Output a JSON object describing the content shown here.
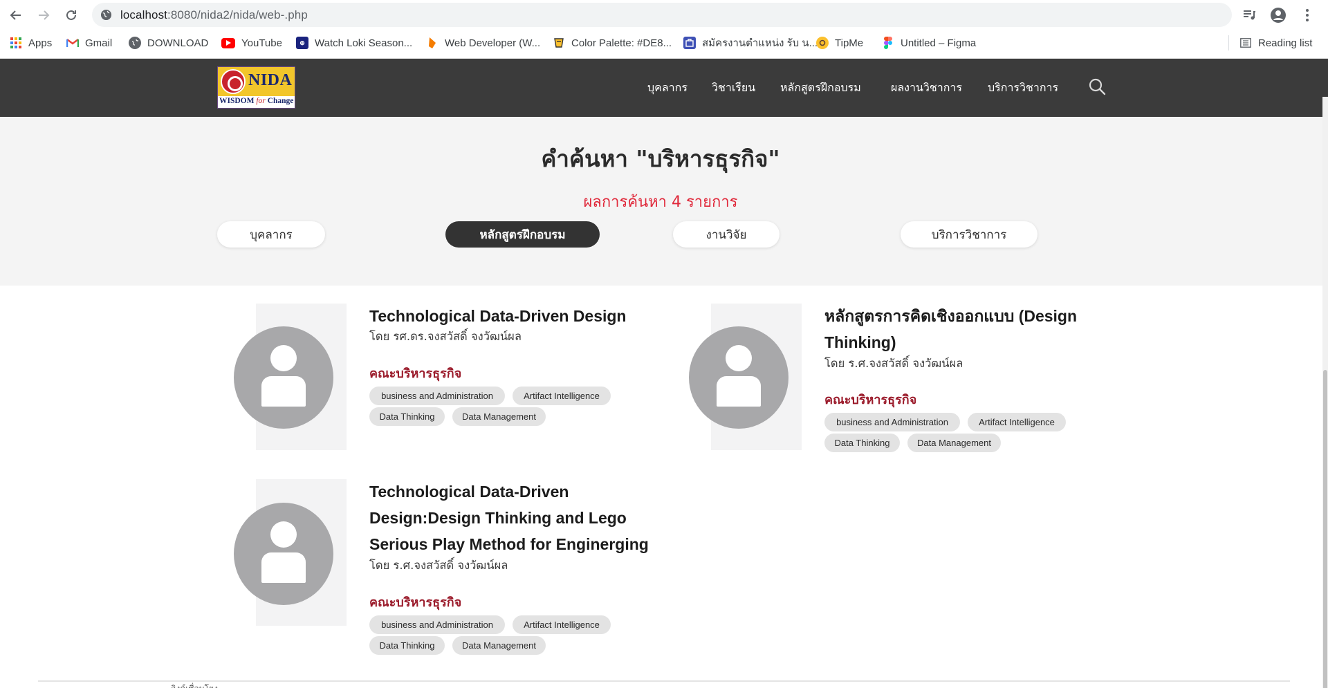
{
  "browser": {
    "url_host": "localhost",
    "url_path": ":8080/nida2/nida/web-.php",
    "bookmarks": [
      {
        "label": "Apps",
        "icon": "apps-grid-icon"
      },
      {
        "label": "Gmail",
        "icon": "gmail-icon"
      },
      {
        "label": "DOWNLOAD",
        "icon": "globe-icon"
      },
      {
        "label": "YouTube",
        "icon": "youtube-icon"
      },
      {
        "label": "Watch Loki Season...",
        "icon": "site-favicon"
      },
      {
        "label": "Web Developer (W...",
        "icon": "site-favicon"
      },
      {
        "label": "Color Palette: #DE8...",
        "icon": "site-favicon"
      },
      {
        "label": "สมัครงานตำแหน่ง รับ น...",
        "icon": "site-favicon"
      },
      {
        "label": "TipMe",
        "icon": "tipme-icon"
      },
      {
        "label": "Untitled – Figma",
        "icon": "figma-icon"
      }
    ],
    "reading_list": "Reading list"
  },
  "header": {
    "logo_name": "NIDA",
    "logo_tagline_a": "WISDOM ",
    "logo_tagline_b": "for",
    "logo_tagline_c": " Change",
    "menu": [
      "บุคลากร",
      "วิชาเรียน",
      "หลักสูตรฝึกอบรม",
      "ผลงานวิชาการ",
      "บริการวิชาการ"
    ]
  },
  "search": {
    "title": "คำค้นหา \"บริหารธุรกิจ\"",
    "result_count": "ผลการค้นหา 4 รายการ",
    "tabs": [
      "บุคลากร",
      "หลักสูตรฝึกอบรม",
      "งานวิจัย",
      "บริการวิชาการ"
    ],
    "active_tab_index": 1
  },
  "results": [
    {
      "title": "Technological Data-Driven Design",
      "author": "โดย รศ.ดร.จงสวัสดิ์ จงวัฒน์ผล",
      "faculty": "คณะบริหารธุรกิจ",
      "tags": [
        "business and Administration",
        "Artifact Intelligence",
        "Data Thinking",
        "Data Management"
      ]
    },
    {
      "title": "หลักสูตรการคิดเชิงออกแบบ (Design Thinking)",
      "author": "โดย ร.ศ.จงสวัสดิ์ จงวัฒน์ผล",
      "faculty": "คณะบริหารธุรกิจ",
      "tags": [
        "business and Administration",
        "Artifact Intelligence",
        "Data Thinking",
        "Data Management"
      ]
    },
    {
      "title": "Technological Data-Driven Design:Design Thinking and Lego Serious Play Method for Enginerging",
      "author": "โดย ร.ศ.จงสวัสดิ์ จงวัฒน์ผล",
      "faculty": "คณะบริหารธุรกิจ",
      "tags": [
        "business and Administration",
        "Artifact Intelligence",
        "Data Thinking",
        "Data Management"
      ]
    }
  ],
  "footer_hint": "ลิงค์เชื่อมโยง",
  "colors": {
    "header_bg": "#3b3b3b",
    "summary_bg": "#f4f4f4",
    "count_red": "#e0283a",
    "faculty_red": "#9b1b2b",
    "active_tab": "#333333"
  }
}
